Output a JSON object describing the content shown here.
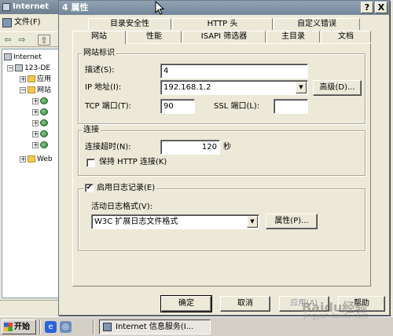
{
  "background_window": {
    "title": "Internet",
    "menu_file": "文件(F)",
    "tree": [
      {
        "label": "Internet",
        "icon": "pc-icon"
      },
      {
        "label": "123-DE",
        "icon": "pc-icon"
      },
      {
        "label": "应用",
        "icon": "folder-icon"
      },
      {
        "label": "网站",
        "icon": "folder-icon"
      },
      {
        "label": "",
        "icon": "globe-icon"
      },
      {
        "label": "",
        "icon": "globe-icon"
      },
      {
        "label": "",
        "icon": "globe-icon"
      },
      {
        "label": "",
        "icon": "globe-icon"
      },
      {
        "label": "",
        "icon": "globe-icon"
      },
      {
        "label": "Web",
        "icon": "folder-icon"
      }
    ]
  },
  "dialog": {
    "title": "4 属性",
    "help_glyph": "?",
    "close_glyph": "X",
    "tabs_back": [
      "目录安全性",
      "HTTP 头",
      "自定义错误"
    ],
    "tabs_front": [
      "网站",
      "性能",
      "ISAPI 筛选器",
      "主目录",
      "文档"
    ],
    "active_tab": "网站",
    "site_id_group": {
      "legend": "网站标识",
      "description_label": "描述(S):",
      "description_value": "4",
      "ip_label": "IP 地址(I):",
      "ip_value": "192.168.1.2",
      "advanced_button": "高级(D)...",
      "tcp_label": "TCP 端口(T):",
      "tcp_value": "90",
      "ssl_label": "SSL 端口(L):",
      "ssl_value": ""
    },
    "connection_group": {
      "legend": "连接",
      "timeout_label": "连接超时(N):",
      "timeout_value": "120",
      "timeout_unit": "秒",
      "keepalive_label": "保持 HTTP 连接(K)",
      "keepalive_checked": false
    },
    "logging": {
      "enable_label": "启用日志记录(E)",
      "enable_checked": true,
      "format_label": "活动日志格式(V):",
      "format_value": "W3C 扩展日志文件格式",
      "properties_button": "属性(P)..."
    },
    "buttons": {
      "ok": "确定",
      "cancel": "取消",
      "apply": "应用(A)",
      "help": "帮助"
    }
  },
  "taskbar": {
    "start_label": "开始",
    "task_label": "Internet 信息服务(I..."
  },
  "watermark": {
    "text": "Baidu经验",
    "url": "jingyan.baidu.com"
  }
}
